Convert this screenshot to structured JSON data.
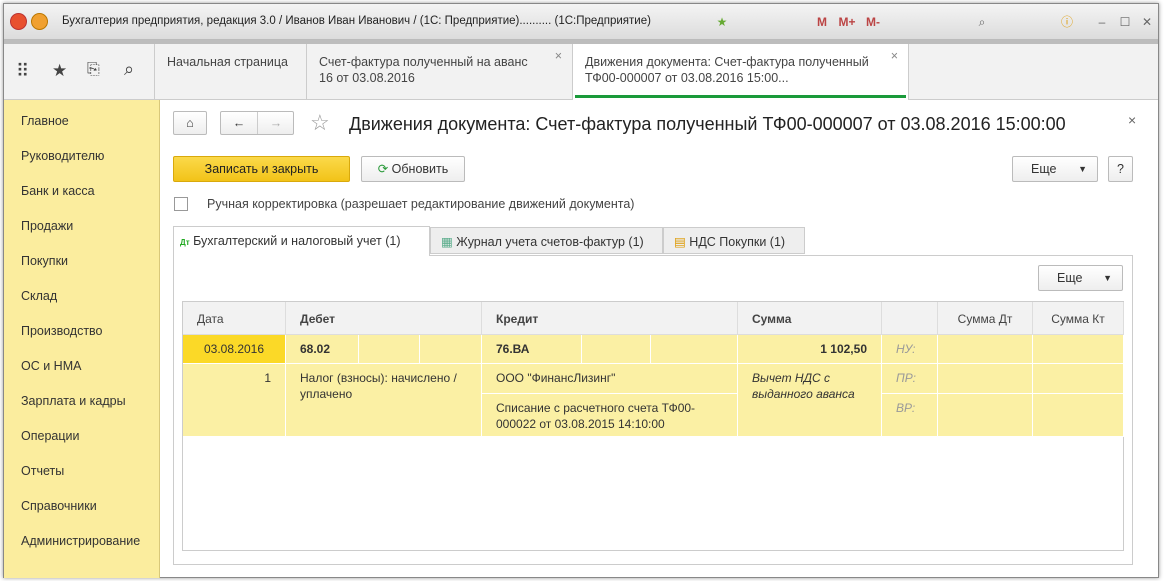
{
  "window": {
    "title": "Бухгалтерия предприятия, редакция 3.0 / Иванов Иван Иванович / (1С: Предприятие)..........  (1С:Предприятие)",
    "toolbar_m": [
      "M",
      "M+",
      "M-"
    ]
  },
  "open_tabs": [
    {
      "label": "Начальная страница"
    },
    {
      "label": "Счет-фактура полученный на аванс 16 от 03.08.2016",
      "close": "×"
    },
    {
      "label": "Движения документа: Счет-фактура полученный ТФ00-000007 от 03.08.2016 15:00...",
      "close": "×",
      "active": true
    }
  ],
  "sidebar": {
    "items": [
      "Главное",
      "Руководителю",
      "Банк и касса",
      "Продажи",
      "Покупки",
      "Склад",
      "Производство",
      "ОС и НМА",
      "Зарплата и кадры",
      "Операции",
      "Отчеты",
      "Справочники",
      "Администрирование"
    ]
  },
  "form": {
    "title": "Движения документа: Счет-фактура полученный ТФ00-000007 от 03.08.2016 15:00:00",
    "close": "×",
    "save_close": "Записать и закрыть",
    "refresh": "Обновить",
    "more": "Еще",
    "help": "?",
    "manual_label": "Ручная корректировка (разрешает редактирование движений документа)",
    "manual_checked": false,
    "tabs": [
      "Бухгалтерский и налоговый учет (1)",
      "Журнал учета счетов-фактур (1)",
      "НДС Покупки (1)"
    ],
    "table_more": "Еще",
    "accent": "#f7cd2c"
  },
  "table": {
    "headers": {
      "date": "Дата",
      "debit": "Дебет",
      "credit": "Кредит",
      "sum": "Сумма",
      "sum_dt": "Сумма Дт",
      "sum_kt": "Сумма Кт"
    },
    "row": {
      "date": "03.08.2016",
      "num": "1",
      "debit": "68.02",
      "credit": "76.ВА",
      "sum": "1 102,50",
      "debit_sub": "Налог (взносы): начислено / уплачено",
      "credit_sub1": "ООО \"ФинансЛизинг\"",
      "credit_sub2": "Списание с расчетного счета ТФ00-000022 от 03.08.2015 14:10:00",
      "content": "Вычет НДС с выданного аванса",
      "nu": "НУ:",
      "pr": "ПР:",
      "vr": "ВР:"
    }
  }
}
